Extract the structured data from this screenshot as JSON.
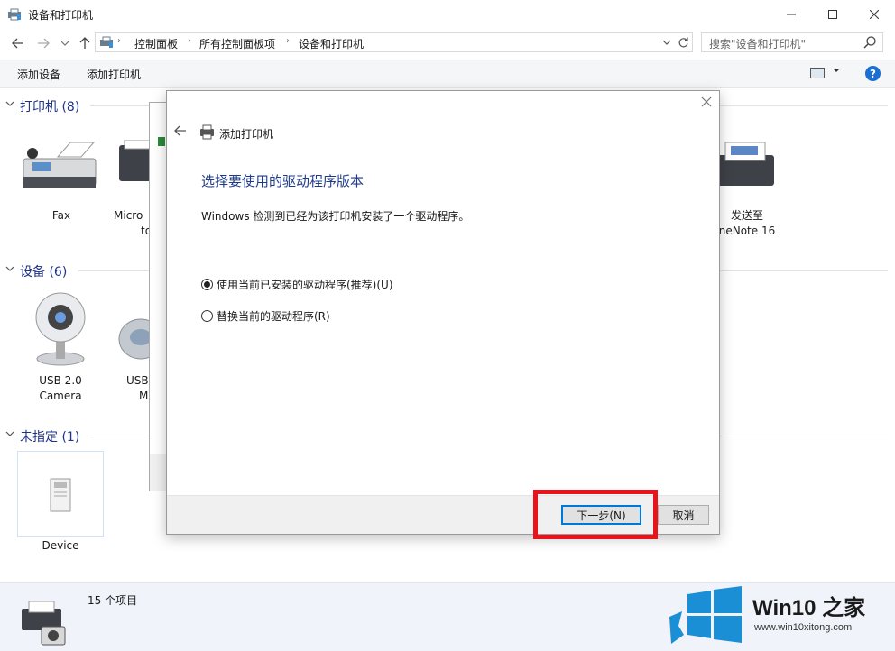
{
  "window": {
    "title": "设备和打印机"
  },
  "address": {
    "crumbs": [
      "控制面板",
      "所有控制面板项",
      "设备和打印机"
    ],
    "search_placeholder": "搜索\"设备和打印机\""
  },
  "toolbar": {
    "add_device": "添加设备",
    "add_printer": "添加打印机",
    "help": "?"
  },
  "groups": {
    "printers": {
      "label": "打印机 (8)",
      "items": [
        {
          "label": "Fax"
        },
        {
          "label": "Micro",
          "label2": "to"
        },
        {
          "label": "发送至",
          "label2": "neNote 16"
        }
      ]
    },
    "devices": {
      "label": "设备 (6)",
      "items": [
        {
          "label": "USB 2.0",
          "label2": "Camera"
        },
        {
          "label": "USB",
          "label2": "M"
        }
      ]
    },
    "unspecified": {
      "label": "未指定 (1)",
      "items": [
        {
          "label": "Device"
        }
      ]
    }
  },
  "dialog": {
    "header": "添加打印机",
    "heading": "选择要使用的驱动程序版本",
    "description": "Windows 检测到已经为该打印机安装了一个驱动程序。",
    "options": [
      {
        "label": "使用当前已安装的驱动程序(推荐)(U)",
        "checked": true
      },
      {
        "label": "替换当前的驱动程序(R)",
        "checked": false
      }
    ],
    "next_button": "下一步(N)",
    "cancel_button": "取消"
  },
  "status": {
    "count": "15 个项目"
  },
  "watermark": {
    "brand": "Win10 之家",
    "url": "www.win10xitong.com"
  },
  "colors": {
    "accent": "#0078d7",
    "highlight": "#e8141c",
    "heading": "#1e3a8a",
    "group": "#1e3287"
  }
}
